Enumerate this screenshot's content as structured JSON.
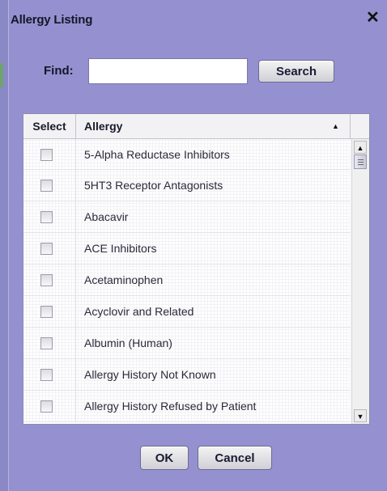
{
  "dialog": {
    "title": "Allergy Listing",
    "close_icon": "close-icon"
  },
  "find": {
    "label": "Find:",
    "value": "",
    "placeholder": "",
    "search_label": "Search"
  },
  "table": {
    "columns": [
      "Select",
      "Allergy"
    ],
    "sort": "ascending",
    "rows": [
      {
        "name": "5-Alpha Reductase Inhibitors",
        "checked": false
      },
      {
        "name": "5HT3 Receptor Antagonists",
        "checked": false
      },
      {
        "name": "Abacavir",
        "checked": false
      },
      {
        "name": "ACE Inhibitors",
        "checked": false
      },
      {
        "name": "Acetaminophen",
        "checked": false
      },
      {
        "name": "Acyclovir and Related",
        "checked": false
      },
      {
        "name": "Albumin (Human)",
        "checked": false
      },
      {
        "name": "Allergy History Not Known",
        "checked": false
      },
      {
        "name": "Allergy History Refused by Patient",
        "checked": false
      }
    ]
  },
  "footer": {
    "ok_label": "OK",
    "cancel_label": "Cancel"
  }
}
